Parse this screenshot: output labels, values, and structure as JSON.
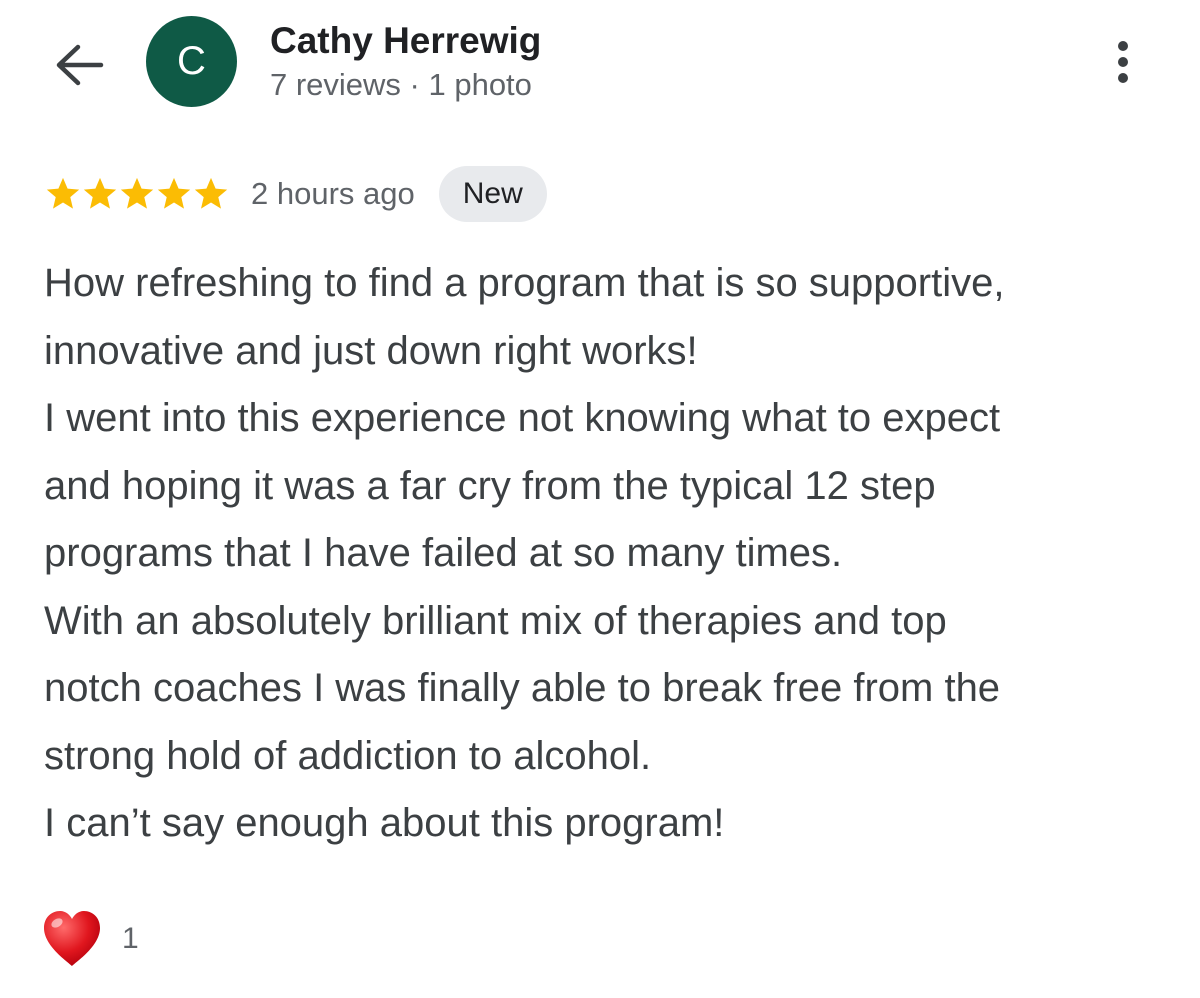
{
  "header": {
    "back_icon": "arrow-left-icon",
    "avatar_letter": "C",
    "avatar_color": "#0f5a46",
    "reviewer_name": "Cathy Herrewig",
    "reviewer_meta": "7 reviews · 1 photo",
    "more_icon": "more-vertical-icon"
  },
  "review": {
    "rating": 5,
    "max_rating": 5,
    "star_color": "#fbbc04",
    "time_ago": "2 hours ago",
    "badge": "New",
    "lines": [
      "How refreshing to find a program that is so supportive,",
      "innovative and just down right works!",
      "I went into this experience not knowing what to expect",
      "and hoping it was a far cry from the typical 12 step",
      "programs that I have failed at so many times.",
      "With an absolutely brilliant mix of therapies and top",
      "notch coaches I was finally able to break free from the",
      "strong hold of addiction to alcohol.",
      "I can’t say enough about this program!"
    ]
  },
  "reaction": {
    "icon": "heart-icon",
    "count": "1"
  }
}
